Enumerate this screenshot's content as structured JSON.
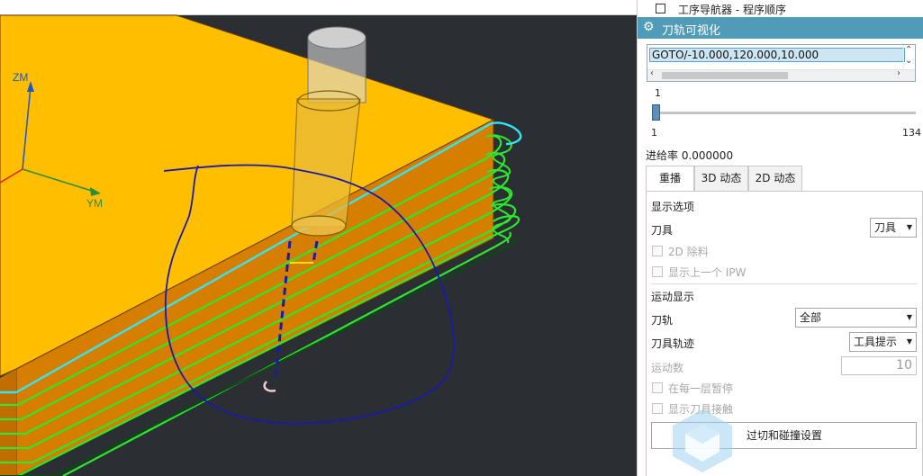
{
  "navigator": {
    "label": "工序导航器 - 程序顺序"
  },
  "panel": {
    "title": "刀轨可视化",
    "gear_icon": "gear-icon",
    "accent_color": "#4f9bb8"
  },
  "listbox": {
    "selected": "GOTO/-10.000,120.000,10.000"
  },
  "slider": {
    "current": "1",
    "min": "1",
    "max": "134",
    "value_fraction": 0.0
  },
  "feed_rate": "进给率 0.000000",
  "tabs": [
    "重播",
    "3D 动态",
    "2D 动态"
  ],
  "active_tab": "重播",
  "display_options": {
    "section_title": "显示选项",
    "tool_label": "刀具",
    "tool_value": "刀具",
    "remove_2d_label": "2D 除料",
    "show_ipw_label": "显示上一个 IPW"
  },
  "motion_display": {
    "section_title": "运动显示",
    "path_label": "刀轨",
    "path_value": "全部",
    "trace_label": "刀具轨迹",
    "trace_value": "工具提示",
    "motion_count_label": "运动数",
    "motion_count_value": "10",
    "pause_label": "在每一层暂停",
    "show_tool_shank_label": "显示刀具接触"
  },
  "buttons": {
    "gouge_check": "过切和碰撞设置"
  },
  "axes": {
    "zm": "ZM",
    "ym": "YM"
  },
  "colors": {
    "stock_top": "#ffbf00",
    "stock_side": "#d67e00",
    "toolpath_green": "#2ee62e",
    "toolpath_cyan": "#33e5f2",
    "annotation_blue": "#1a1aa8",
    "viewport_bg": "#2b2f33"
  }
}
